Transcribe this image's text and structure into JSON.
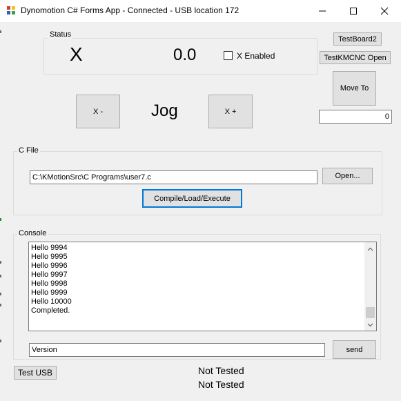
{
  "window": {
    "title": "Dynomotion C# Forms App - Connected - USB location 172"
  },
  "status_group": {
    "label": "Status",
    "axis_name": "X",
    "position": "0.0",
    "enable_label": "X Enabled",
    "enable_checked": false
  },
  "top_right": {
    "testboard2": "TestBoard2",
    "testkmcnc": "TestKMCNC Open",
    "move_to": "Move To",
    "move_value": "0"
  },
  "jog": {
    "minus": "X -",
    "label": "Jog",
    "plus": "X +"
  },
  "cfile_group": {
    "label": "C File",
    "path": "C:\\KMotionSrc\\C Programs\\user7.c",
    "open": "Open...",
    "compile": "Compile/Load/Execute"
  },
  "console_group": {
    "label": "Console",
    "lines": "Hello 9994\nHello 9995\nHello 9996\nHello 9997\nHello 9998\nHello 9999\nHello 10000\nCompleted.",
    "command": "Version",
    "send": "send"
  },
  "bottom": {
    "test_usb": "Test USB",
    "status1": "Not Tested",
    "status2": "Not Tested"
  }
}
